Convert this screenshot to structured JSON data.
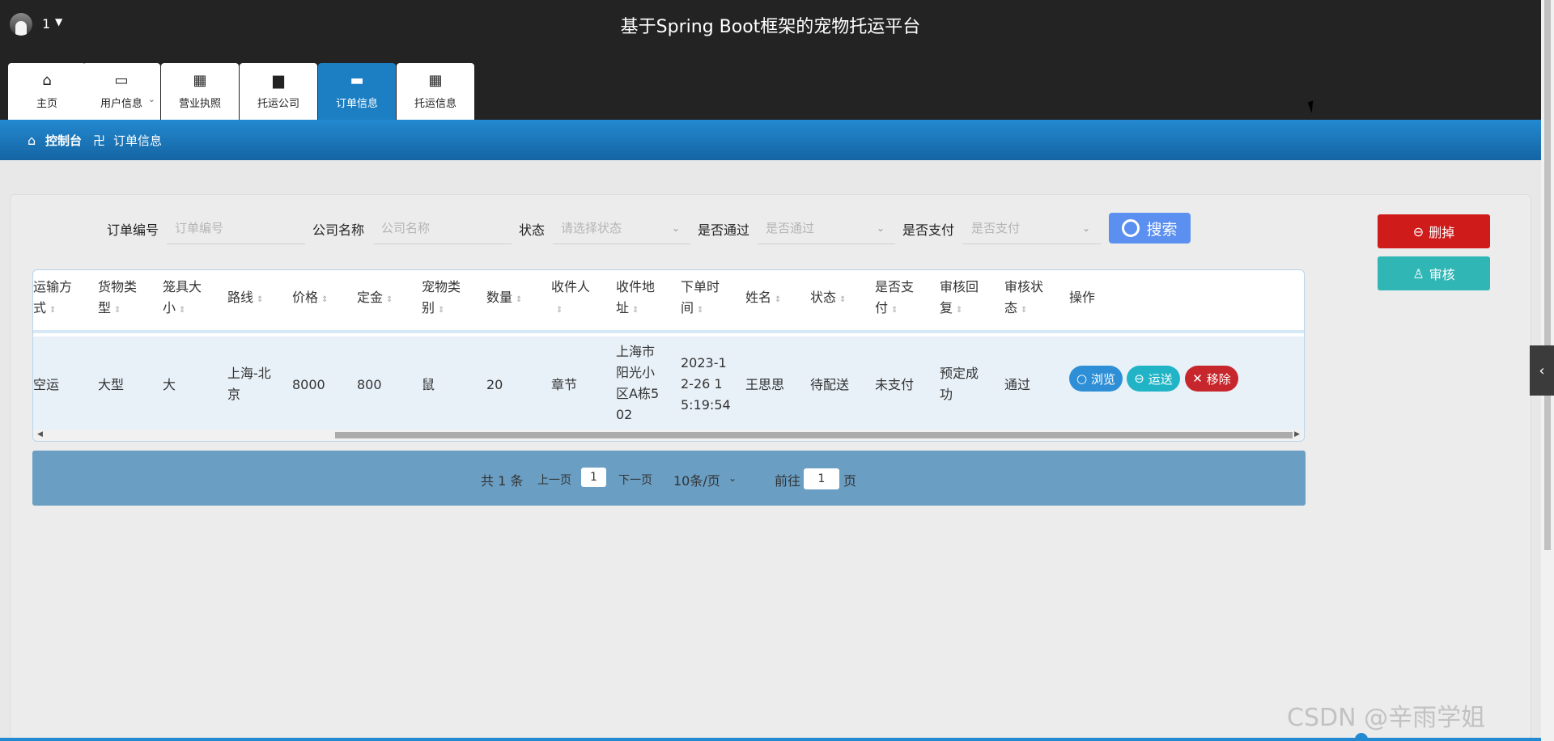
{
  "header": {
    "username": "1",
    "title": "基于Spring Boot框架的宠物托运平台"
  },
  "nav": {
    "tabs": [
      {
        "label": "主页",
        "icon": "home-icon"
      },
      {
        "label": "用户信息",
        "icon": "wallet-icon"
      },
      {
        "label": "营业执照",
        "icon": "grid-icon"
      },
      {
        "label": "托运公司",
        "icon": "briefcase-icon"
      },
      {
        "label": "订单信息",
        "icon": "chat-icon",
        "active": true
      },
      {
        "label": "托运信息",
        "icon": "grid-icon"
      }
    ]
  },
  "breadcrumb": {
    "home": "控制台",
    "separator": "卍",
    "current": "订单信息"
  },
  "filters": {
    "order_no": {
      "label": "订单编号",
      "placeholder": "订单编号"
    },
    "company": {
      "label": "公司名称",
      "placeholder": "公司名称"
    },
    "status": {
      "label": "状态",
      "placeholder": "请选择状态"
    },
    "passed": {
      "label": "是否通过",
      "placeholder": "是否通过"
    },
    "paid": {
      "label": "是否支付",
      "placeholder": "是否支付"
    },
    "search_label": "搜索"
  },
  "actions": {
    "delete_label": "删掉",
    "audit_label": "审核"
  },
  "table": {
    "columns": [
      {
        "line1": "运输方",
        "line2": "式"
      },
      {
        "line1": "货物类",
        "line2": "型"
      },
      {
        "line1": "笼具大",
        "line2": "小"
      },
      {
        "line1": "路线",
        "line2": ""
      },
      {
        "line1": "价格",
        "line2": ""
      },
      {
        "line1": "定金",
        "line2": ""
      },
      {
        "line1": "宠物类",
        "line2": "别"
      },
      {
        "line1": "数量",
        "line2": ""
      },
      {
        "line1": "收件人",
        "line2": ""
      },
      {
        "line1": "收件地",
        "line2": "址"
      },
      {
        "line1": "下单时",
        "line2": "间"
      },
      {
        "line1": "姓名",
        "line2": ""
      },
      {
        "line1": "状态",
        "line2": ""
      },
      {
        "line1": "是否支",
        "line2": "付"
      },
      {
        "line1": "审核回",
        "line2": "复"
      },
      {
        "line1": "审核状",
        "line2": "态"
      },
      {
        "line1": "操作",
        "line2": ""
      }
    ],
    "row": {
      "transport": "空运",
      "cargo_type": "大型",
      "cage_size": "大",
      "route_1": "上海-北",
      "route_2": "京",
      "price": "8000",
      "deposit": "800",
      "pet_type": "鼠",
      "quantity": "20",
      "recipient": "章节",
      "addr_1": "上海市",
      "addr_2": "阳光小",
      "addr_3": "区A栋5",
      "addr_4": "02",
      "time_1": "2023-1",
      "time_2": "2-26 1",
      "time_3": "5:19:54",
      "name": "王思思",
      "status": "待配送",
      "paid": "未支付",
      "reply_1": "预定成",
      "reply_2": "功",
      "audit_status": "通过"
    },
    "row_actions": {
      "view": "浏览",
      "ship": "运送",
      "remove": "移除"
    }
  },
  "pagination": {
    "total": "共 1 条",
    "prev": "上一页",
    "current_page": "1",
    "next": "下一页",
    "page_size": "10条/页",
    "goto_label": "前往",
    "goto_value": "1",
    "page_unit": "页"
  },
  "watermark": "CSDN @辛雨学姐",
  "colors": {
    "accent": "#1c7fc4",
    "danger": "#d01b1b",
    "teal": "#30b6b4",
    "search": "#5b8ff0"
  }
}
